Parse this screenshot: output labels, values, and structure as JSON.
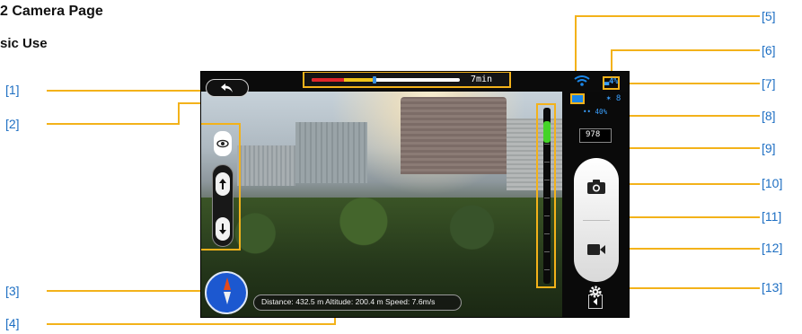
{
  "section": {
    "title": "2 Camera Page",
    "subtitle": "sic Use"
  },
  "callouts": [
    "[1]",
    "[2]",
    "[3]",
    "[4]",
    "[5]",
    "[6]",
    "[7]",
    "[8]",
    "[9]",
    "[10]",
    "[11]",
    "[12]",
    "[13]"
  ],
  "screen": {
    "battery_time_text": "7min",
    "battery": {
      "red_fraction": 0.22,
      "yellow_fraction": 0.41,
      "marker_position": 0.41
    },
    "satellites_text": "▃4‏‏%",
    "gps_text": "✶ 8",
    "signal_text": "•• 40%",
    "altitude_readout": "978",
    "telemetry": "Distance: 432.5 m  Altitude: 200.4 m  Speed: 7.6m/s",
    "accent_color": "#f3b21a",
    "callout_color": "#1e6fc3",
    "icons": {
      "back": "back-arrow-icon",
      "eye": "eye-icon",
      "up": "up-arrow-icon",
      "down": "down-arrow-icon",
      "compass": "compass-icon",
      "wifi": "wifi-icon",
      "photo": "camera-icon",
      "video": "video-camera-icon",
      "settings": "gear-icon",
      "collapse": "collapse-arrow-icon"
    }
  }
}
